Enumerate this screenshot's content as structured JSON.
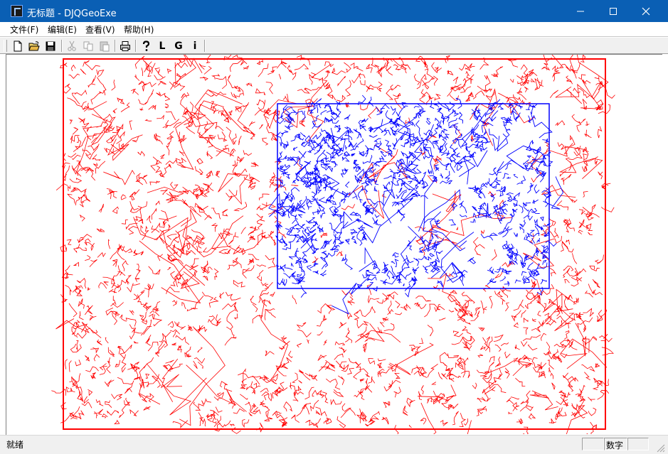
{
  "window": {
    "title": "无标题 - DJQGeoExe",
    "icon": "app-icon"
  },
  "window_controls": {
    "minimize": "minimize-icon",
    "maximize": "maximize-icon",
    "close": "close-icon"
  },
  "menu": {
    "items": [
      {
        "label": "文件(F)"
      },
      {
        "label": "编辑(E)"
      },
      {
        "label": "查看(V)"
      },
      {
        "label": "帮助(H)"
      }
    ]
  },
  "toolbar": {
    "buttons": [
      {
        "icon": "new-file-icon",
        "enabled": true
      },
      {
        "icon": "open-folder-icon",
        "enabled": true
      },
      {
        "icon": "save-icon",
        "enabled": true
      },
      {
        "icon": "cut-icon",
        "enabled": false
      },
      {
        "icon": "copy-icon",
        "enabled": false
      },
      {
        "icon": "paste-icon",
        "enabled": false
      },
      {
        "icon": "print-icon",
        "enabled": true
      },
      {
        "icon": "help-icon",
        "enabled": true
      },
      {
        "label": "L"
      },
      {
        "label": "G"
      },
      {
        "label": "i"
      }
    ]
  },
  "map": {
    "layers": [
      {
        "color": "#ff0000"
      },
      {
        "color": "#0000ff"
      }
    ]
  },
  "status": {
    "text": "就绪",
    "panes": [
      "",
      "数字",
      ""
    ]
  }
}
